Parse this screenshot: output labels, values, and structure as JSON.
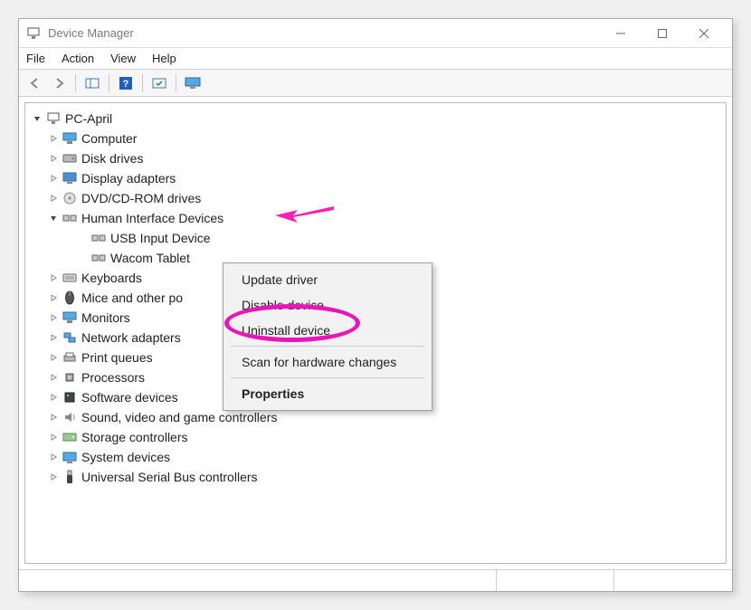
{
  "titlebar": {
    "title": "Device Manager"
  },
  "menubar": {
    "file": "File",
    "action": "Action",
    "view": "View",
    "help": "Help"
  },
  "tree": {
    "root": "PC-April",
    "nodes": [
      {
        "label": "Computer",
        "icon": "monitor"
      },
      {
        "label": "Disk drives",
        "icon": "disk"
      },
      {
        "label": "Display adapters",
        "icon": "display"
      },
      {
        "label": "DVD/CD-ROM drives",
        "icon": "cdrom"
      },
      {
        "label": "Human Interface Devices",
        "icon": "hid",
        "expanded": true,
        "children": [
          {
            "label": "USB Input Device",
            "icon": "hid"
          },
          {
            "label": "Wacom Tablet",
            "icon": "hid"
          }
        ]
      },
      {
        "label": "Keyboards",
        "icon": "keyboard"
      },
      {
        "label": "Mice and other po",
        "icon": "mouse"
      },
      {
        "label": "Monitors",
        "icon": "monitor"
      },
      {
        "label": "Network adapters",
        "icon": "network"
      },
      {
        "label": "Print queues",
        "icon": "printer"
      },
      {
        "label": "Processors",
        "icon": "cpu"
      },
      {
        "label": "Software devices",
        "icon": "software"
      },
      {
        "label": "Sound, video and game controllers",
        "icon": "sound"
      },
      {
        "label": "Storage controllers",
        "icon": "storage"
      },
      {
        "label": "System devices",
        "icon": "system"
      },
      {
        "label": "Universal Serial Bus controllers",
        "icon": "usb"
      }
    ]
  },
  "context_menu": {
    "update": "Update driver",
    "disable": "Disable device",
    "uninstall": "Uninstall device",
    "scan": "Scan for hardware changes",
    "properties": "Properties"
  },
  "annotations": {
    "arrow_color": "#ff1fb0",
    "circle_color": "#e815b7"
  }
}
